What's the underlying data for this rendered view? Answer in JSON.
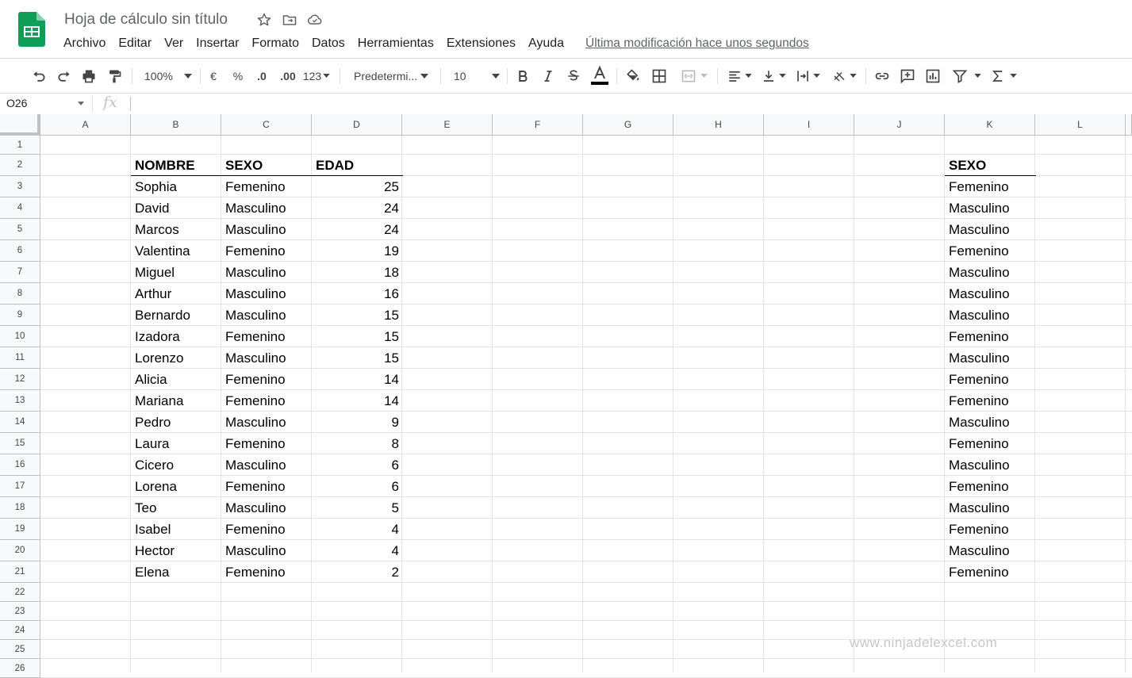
{
  "app": {
    "doc_title": "Hoja de cálculo sin título",
    "last_edit": "Última modificación hace unos segundos",
    "brand_color": "#0f9d58"
  },
  "menu": [
    "Archivo",
    "Editar",
    "Ver",
    "Insertar",
    "Formato",
    "Datos",
    "Herramientas",
    "Extensiones",
    "Ayuda"
  ],
  "toolbar": {
    "zoom": "100%",
    "currency": "€",
    "percent": "%",
    "dec_less": ".0",
    "dec_more": ".00",
    "more_formats": "123",
    "font": "Predetermi...",
    "font_size": "10"
  },
  "formula_bar": {
    "name_box": "O26",
    "fx_label": "fx",
    "value": ""
  },
  "columns": [
    "A",
    "B",
    "C",
    "D",
    "E",
    "F",
    "G",
    "H",
    "I",
    "J",
    "K",
    "L"
  ],
  "rows": [
    "1",
    "2",
    "3",
    "4",
    "5",
    "6",
    "7",
    "8",
    "9",
    "10",
    "11",
    "12",
    "13",
    "14",
    "15",
    "16",
    "17",
    "18",
    "19",
    "20",
    "21",
    "22",
    "23",
    "24",
    "25",
    "26"
  ],
  "table": {
    "headers": [
      "NOMBRE",
      "SEXO",
      "EDAD"
    ],
    "records": [
      [
        "Sophia",
        "Femenino",
        "25"
      ],
      [
        "David",
        "Masculino",
        "24"
      ],
      [
        "Marcos",
        "Masculino",
        "24"
      ],
      [
        "Valentina",
        "Femenino",
        "19"
      ],
      [
        "Miguel",
        "Masculino",
        "18"
      ],
      [
        "Arthur",
        "Masculino",
        "16"
      ],
      [
        "Bernardo",
        "Masculino",
        "15"
      ],
      [
        "Izadora",
        "Femenino",
        "15"
      ],
      [
        "Lorenzo",
        "Masculino",
        "15"
      ],
      [
        "Alicia",
        "Femenino",
        "14"
      ],
      [
        "Mariana",
        "Femenino",
        "14"
      ],
      [
        "Pedro",
        "Masculino",
        "9"
      ],
      [
        "Laura",
        "Femenino",
        "8"
      ],
      [
        "Cicero",
        "Masculino",
        "6"
      ],
      [
        "Lorena",
        "Femenino",
        "6"
      ],
      [
        "Teo",
        "Masculino",
        "5"
      ],
      [
        "Isabel",
        "Femenino",
        "4"
      ],
      [
        "Hector",
        "Masculino",
        "4"
      ],
      [
        "Elena",
        "Femenino",
        "2"
      ]
    ]
  },
  "side_table": {
    "header": "SEXO",
    "values": [
      "Femenino",
      "Masculino",
      "Masculino",
      "Femenino",
      "Masculino",
      "Masculino",
      "Masculino",
      "Femenino",
      "Masculino",
      "Femenino",
      "Femenino",
      "Masculino",
      "Femenino",
      "Masculino",
      "Femenino",
      "Masculino",
      "Femenino",
      "Masculino",
      "Femenino"
    ]
  },
  "watermark": "www.ninjadelexcel.com"
}
